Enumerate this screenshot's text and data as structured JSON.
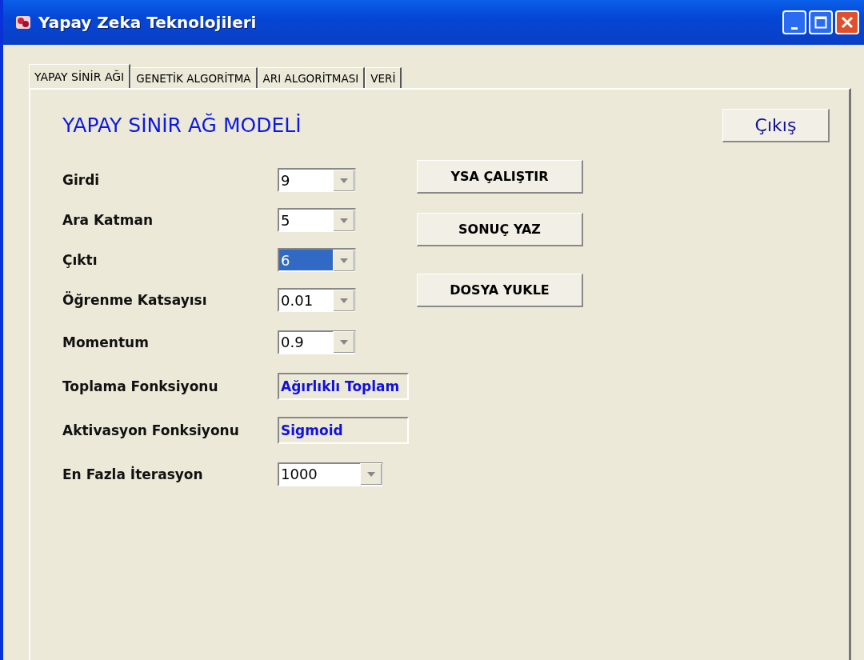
{
  "window": {
    "title": "Yapay Zeka Teknolojileri"
  },
  "tabs": [
    {
      "label": "YAPAY SİNİR AĞI",
      "selected": true
    },
    {
      "label": "GENETİK ALGORİTMA",
      "selected": false
    },
    {
      "label": "ARI ALGORİTMASI",
      "selected": false
    },
    {
      "label": "VERİ",
      "selected": false
    }
  ],
  "panel": {
    "heading": "YAPAY SİNİR AĞ MODELİ",
    "exit_button": "Çıkış",
    "fields": [
      {
        "kind": "combo",
        "label": "Girdi",
        "value": "9",
        "highlighted": false
      },
      {
        "kind": "combo",
        "label": "Ara Katman",
        "value": "5",
        "highlighted": false
      },
      {
        "kind": "combo",
        "label": "Çıktı",
        "value": "6",
        "highlighted": true
      },
      {
        "kind": "combo",
        "label": "Öğrenme Katsayısı",
        "value": "0.01",
        "highlighted": false
      },
      {
        "kind": "combo",
        "label": "Momentum",
        "value": "0.9",
        "highlighted": false
      },
      {
        "kind": "readonly",
        "label": "Toplama Fonksiyonu",
        "value": "Ağırlıklı Toplam"
      },
      {
        "kind": "readonly",
        "label": "Aktivasyon Fonksiyonu",
        "value": "Sigmoid"
      },
      {
        "kind": "wide-combo",
        "label": "En Fazla İterasyon",
        "value": "1000",
        "highlighted": false
      }
    ],
    "buttons": [
      "YSA ÇALIŞTIR",
      "SONUÇ YAZ",
      "DOSYA YUKLE"
    ]
  }
}
